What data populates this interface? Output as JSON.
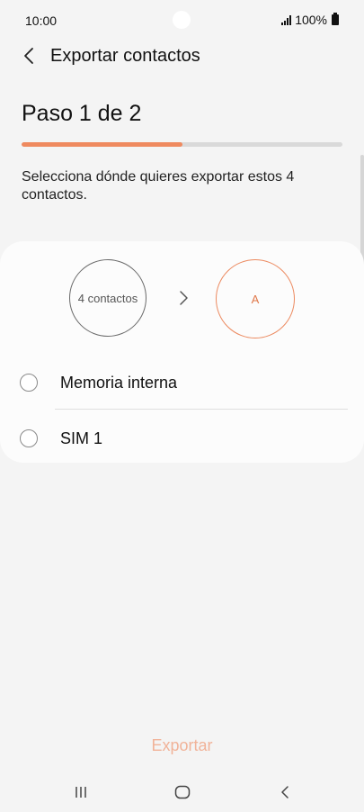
{
  "status_bar": {
    "time": "10:00",
    "battery": "100%",
    "icons": [
      "camera-dot",
      "signal-icon",
      "battery-icon"
    ]
  },
  "header": {
    "title": "Exportar contactos",
    "back_icon": "chevron-left-icon"
  },
  "step": {
    "title": "Paso 1 de 2",
    "progress": 0.5
  },
  "description": "Selecciona dónde quieres exportar estos 4 contactos.",
  "transfer": {
    "source_label": "4 contactos",
    "target_label": "A",
    "arrow_icon": "chevron-right-icon"
  },
  "options": [
    {
      "label": "Memoria interna",
      "selected": false
    },
    {
      "label": "SIM 1",
      "selected": false
    }
  ],
  "export_label": "Exportar",
  "nav_bar": {
    "icons": [
      "recents-icon",
      "home-icon",
      "back-icon"
    ]
  },
  "colors": {
    "accent": "#ef8a5f",
    "accent_disabled": "#f1b399",
    "background": "#f4f4f4",
    "card": "#fcfcfc"
  }
}
